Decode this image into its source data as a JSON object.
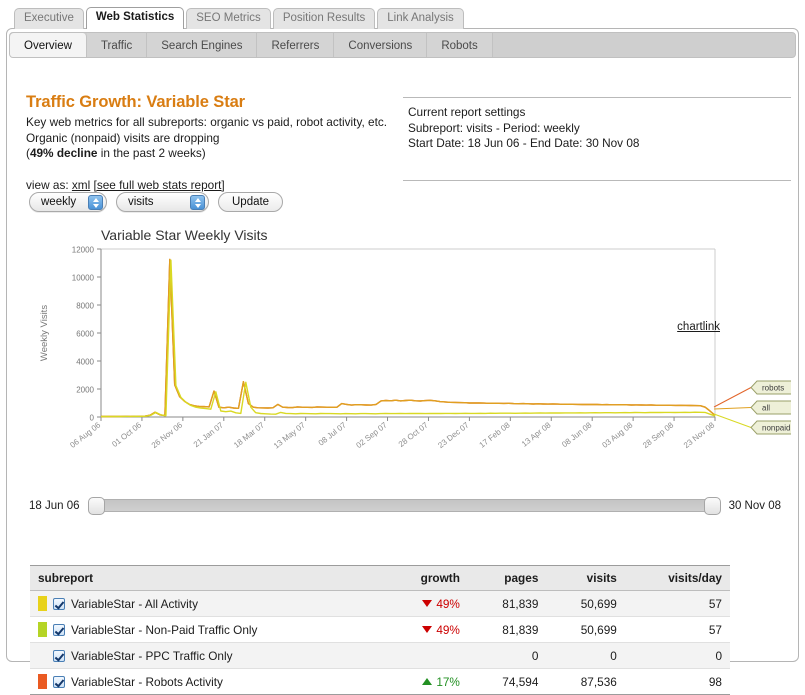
{
  "outer_tabs": [
    {
      "label": "Executive",
      "active": false
    },
    {
      "label": "Web Statistics",
      "active": true
    },
    {
      "label": "SEO Metrics",
      "active": false
    },
    {
      "label": "Position Results",
      "active": false
    },
    {
      "label": "Link Analysis",
      "active": false
    }
  ],
  "inner_tabs": [
    {
      "label": "Overview",
      "active": true
    },
    {
      "label": "Traffic",
      "active": false
    },
    {
      "label": "Search Engines",
      "active": false
    },
    {
      "label": "Referrers",
      "active": false
    },
    {
      "label": "Conversions",
      "active": false
    },
    {
      "label": "Robots",
      "active": false
    }
  ],
  "header": {
    "title": "Traffic Growth: Variable Star",
    "line1": "Key web metrics for all subreports: organic vs paid, robot activity, etc.",
    "line2": "Organic (nonpaid) visits are dropping",
    "line3_prefix": "(",
    "line3_bold": "49% decline",
    "line3_suffix": " in the past 2 weeks)",
    "view_as_label": "view as:",
    "xml_link": "xml",
    "full_report_link": "[see full web stats report]",
    "title_color": "#d97d12"
  },
  "settings": {
    "line1": "Current report settings",
    "line2": "Subreport: visits - Period: weekly",
    "line3": "Start Date: 18 Jun 06 - End Date: 30 Nov 08"
  },
  "controls": {
    "period_value": "weekly",
    "metric_value": "visits",
    "update_label": "Update"
  },
  "slider": {
    "start_date": "18 Jun 06",
    "end_date": "30 Nov 08"
  },
  "chartlink_label": "chartlink",
  "chart_data": {
    "type": "line",
    "title": "Variable Star Weekly Visits",
    "xlabel": "",
    "ylabel": "Weekly Visits",
    "ylim": [
      0,
      12000
    ],
    "yticks": [
      0,
      2000,
      4000,
      6000,
      8000,
      10000,
      12000
    ],
    "grid": false,
    "legend_position": "right-callouts",
    "xtick_labels": [
      "06 Aug 06",
      "01 Oct 06",
      "26 Nov 06",
      "21 Jan 07",
      "18 Mar 07",
      "13 May 07",
      "08 Jul 07",
      "02 Sep 07",
      "28 Oct 07",
      "23 Dec 07",
      "17 Feb 08",
      "13 Apr 08",
      "08 Jun 08",
      "03 Aug 08",
      "28 Sep 08",
      "23 Nov 08"
    ],
    "series": [
      {
        "name": "nonpaid",
        "color": "#d9d923",
        "callout": "nonpaid",
        "values": [
          30,
          35,
          30,
          40,
          35,
          45,
          40,
          50,
          45,
          60,
          120,
          330,
          150,
          90,
          11200,
          2250,
          1400,
          1050,
          820,
          700,
          640,
          600,
          560,
          1800,
          430,
          380,
          420,
          300,
          260,
          2480,
          700,
          310,
          250,
          230,
          210,
          200,
          330,
          260,
          240,
          230,
          250,
          240,
          235,
          230,
          250,
          245,
          240,
          235,
          230,
          240,
          235,
          230,
          245,
          240,
          235,
          230,
          240,
          250,
          245,
          240,
          250,
          245,
          250,
          255,
          250,
          245,
          250,
          255,
          250,
          260,
          255,
          250,
          260,
          265,
          260,
          255,
          265,
          260,
          270,
          265,
          270,
          275,
          270,
          265,
          275,
          280,
          275,
          280,
          285,
          280,
          285,
          290,
          285,
          290,
          295,
          290,
          300,
          295,
          300,
          305,
          300,
          310,
          305,
          300,
          310,
          315,
          310,
          320,
          315,
          310,
          320,
          325,
          320,
          330,
          325,
          320,
          330,
          335,
          330,
          340,
          335,
          330,
          200,
          80
        ]
      },
      {
        "name": "all",
        "color": "#e0a020",
        "callout": "all",
        "values": [
          35,
          40,
          35,
          45,
          40,
          50,
          45,
          55,
          50,
          65,
          130,
          345,
          160,
          100,
          11250,
          2300,
          1460,
          1120,
          900,
          800,
          760,
          740,
          720,
          1850,
          700,
          660,
          700,
          640,
          620,
          2520,
          960,
          700,
          660,
          650,
          640,
          660,
          900,
          700,
          680,
          670,
          720,
          700,
          690,
          685,
          720,
          710,
          700,
          695,
          690,
          960,
          900,
          850,
          880,
          870,
          860,
          850,
          900,
          1150,
          1180,
          1160,
          1200,
          1150,
          1180,
          1200,
          1160,
          1140,
          1170,
          1190,
          1160,
          1100,
          1080,
          1050,
          1040,
          1030,
          1020,
          1000,
          1010,
          1000,
          990,
          980,
          985,
          975,
          970,
          980,
          960,
          950,
          960,
          940,
          930,
          940,
          930,
          920,
          930,
          920,
          910,
          915,
          905,
          900,
          895,
          890,
          900,
          890,
          880,
          885,
          875,
          870,
          880,
          870,
          860,
          865,
          855,
          850,
          855,
          845,
          840,
          845,
          835,
          830,
          835,
          825,
          820,
          815,
          810,
          700,
          420,
          120
        ]
      },
      {
        "name": "robots",
        "color": "#e2652a",
        "callout": "robots",
        "values": [
          35,
          40,
          35,
          45,
          40,
          50,
          45,
          55,
          50,
          65,
          130,
          345,
          160,
          100,
          11250,
          2300,
          1460,
          1120,
          900,
          800,
          760,
          740,
          720,
          1850,
          700,
          660,
          700,
          640,
          620,
          2520,
          960,
          700,
          660,
          650,
          640,
          660,
          900,
          700,
          680,
          670,
          720,
          700,
          690,
          685,
          720,
          710,
          700,
          695,
          690,
          960,
          900,
          850,
          880,
          870,
          860,
          850,
          900,
          1150,
          1180,
          1160,
          1200,
          1150,
          1180,
          1200,
          1160,
          1140,
          1170,
          1190,
          1160,
          1100,
          1080,
          1050,
          1040,
          1030,
          1020,
          1000,
          1010,
          1000,
          990,
          980,
          985,
          975,
          970,
          980,
          960,
          950,
          960,
          940,
          930,
          940,
          930,
          920,
          930,
          920,
          910,
          915,
          905,
          900,
          895,
          890,
          900,
          890,
          880,
          885,
          875,
          870,
          880,
          870,
          860,
          865,
          855,
          850,
          855,
          845,
          840,
          845,
          835,
          830,
          835,
          825,
          820,
          815,
          810,
          700,
          420,
          120
        ]
      }
    ]
  },
  "table": {
    "columns": [
      "subreport",
      "growth",
      "pages",
      "visits",
      "visits/day"
    ],
    "rows": [
      {
        "swatch": "#e8d21a",
        "checked": true,
        "name": "VariableStar - All Activity",
        "growth": "49%",
        "growth_dir": "down",
        "pages": "81,839",
        "visits": "50,699",
        "visits_per_day": "57"
      },
      {
        "swatch": "#b5d425",
        "checked": true,
        "name": "VariableStar - Non-Paid Traffic Only",
        "growth": "49%",
        "growth_dir": "down",
        "pages": "81,839",
        "visits": "50,699",
        "visits_per_day": "57"
      },
      {
        "swatch": "",
        "checked": true,
        "name": "VariableStar - PPC Traffic Only",
        "growth": "",
        "growth_dir": "none",
        "pages": "0",
        "visits": "0",
        "visits_per_day": "0"
      },
      {
        "swatch": "#ea5a22",
        "checked": true,
        "name": "VariableStar - Robots Activity",
        "growth": "17%",
        "growth_dir": "up",
        "pages": "74,594",
        "visits": "87,536",
        "visits_per_day": "98"
      }
    ]
  }
}
